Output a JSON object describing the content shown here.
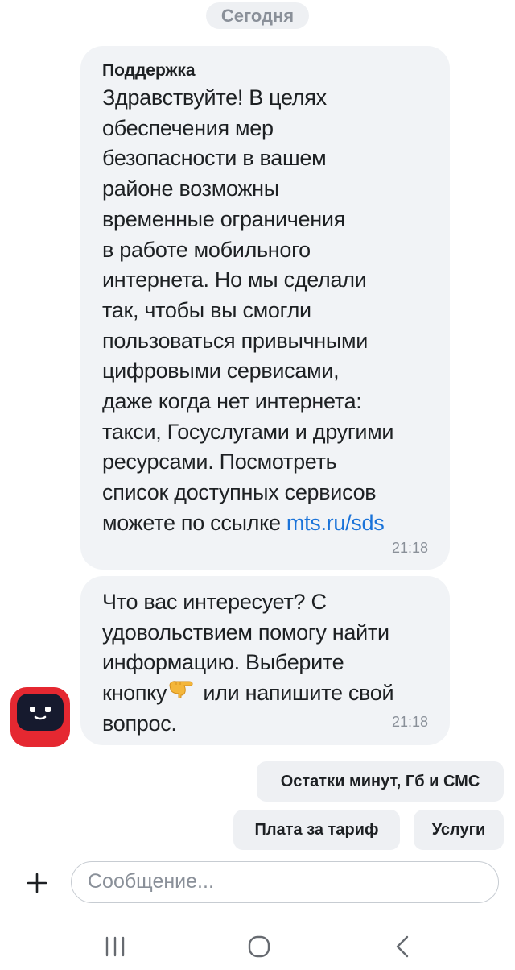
{
  "chat": {
    "date_label": "Сегодня",
    "messages": [
      {
        "sender": "Поддержка",
        "lines": [
          "Здравствуйте! В целях",
          "обеспечения мер",
          "безопасности в вашем",
          "районе возможны",
          "временные ограничения",
          "в работе мобильного",
          "интернета. Но мы сделали",
          "так, чтобы вы смогли",
          "пользоваться привычными",
          "цифровыми сервисами,",
          "даже когда нет интернета:",
          "такси, Госуслугами и другими",
          "ресурсами. Посмотреть",
          "список доступных сервисов"
        ],
        "last_line_prefix": "можете по ссылке ",
        "link_text": "mts.ru/sds",
        "time": "21:18"
      },
      {
        "lines": [
          "Что вас интересует? С",
          "удовольствием помогу найти",
          "информацию. Выберите"
        ],
        "line4_before_emoji": "кнопку",
        "line4_after_emoji": " или напишите свой",
        "line5": "вопрос.",
        "emoji": "backhand-index-pointing-down-icon",
        "time": "21:18"
      }
    ]
  },
  "quick_replies": [
    "Остатки минут, Гб и СМС",
    "Плата за тариф",
    "Услуги"
  ],
  "composer": {
    "placeholder": "Сообщение..."
  },
  "colors": {
    "bubble": "#f1f3f6",
    "link": "#1a73d9",
    "avatar": "#e52831",
    "muted_text": "#8a9099"
  },
  "icons": {
    "attach": "plus-icon",
    "nav_recent": "recent-apps-icon",
    "nav_home": "home-icon",
    "nav_back": "back-icon"
  }
}
